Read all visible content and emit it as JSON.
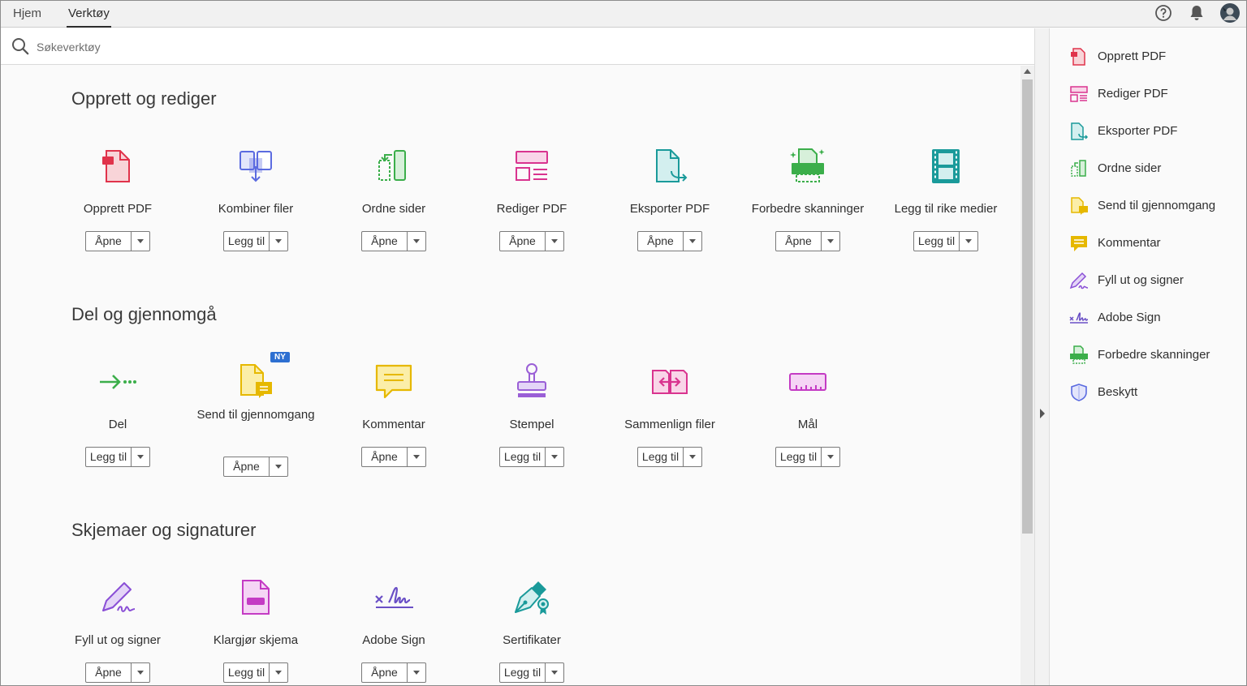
{
  "tabs": {
    "home": "Hjem",
    "tools": "Verktøy"
  },
  "search": {
    "placeholder": "Søkeverktøy"
  },
  "sections": [
    {
      "title": "Opprett og rediger",
      "tools": [
        {
          "label": "Opprett PDF",
          "button": "Åpne",
          "icon": "create-pdf-icon"
        },
        {
          "label": "Kombiner filer",
          "button": "Legg til",
          "icon": "combine-files-icon"
        },
        {
          "label": "Ordne sider",
          "button": "Åpne",
          "icon": "organize-pages-icon"
        },
        {
          "label": "Rediger PDF",
          "button": "Åpne",
          "icon": "edit-pdf-icon"
        },
        {
          "label": "Eksporter PDF",
          "button": "Åpne",
          "icon": "export-pdf-icon"
        },
        {
          "label": "Forbedre skanninger",
          "button": "Åpne",
          "icon": "enhance-scans-icon"
        },
        {
          "label": "Legg til rike medier",
          "button": "Legg til",
          "icon": "rich-media-icon"
        }
      ]
    },
    {
      "title": "Del og gjennomgå",
      "tools": [
        {
          "label": "Del",
          "button": "Legg til",
          "icon": "share-icon"
        },
        {
          "label": "Send til gjennomgang",
          "button": "Åpne",
          "icon": "send-review-icon",
          "badge": "NY"
        },
        {
          "label": "Kommentar",
          "button": "Åpne",
          "icon": "comment-icon"
        },
        {
          "label": "Stempel",
          "button": "Legg til",
          "icon": "stamp-icon"
        },
        {
          "label": "Sammenlign filer",
          "button": "Legg til",
          "icon": "compare-files-icon"
        },
        {
          "label": "Mål",
          "button": "Legg til",
          "icon": "measure-icon"
        }
      ]
    },
    {
      "title": "Skjemaer og signaturer",
      "tools": [
        {
          "label": "Fyll ut og signer",
          "button": "Åpne",
          "icon": "fill-sign-icon"
        },
        {
          "label": "Klargjør skjema",
          "button": "Legg til",
          "icon": "prepare-form-icon"
        },
        {
          "label": "Adobe Sign",
          "button": "Åpne",
          "icon": "adobe-sign-icon"
        },
        {
          "label": "Sertifikater",
          "button": "Legg til",
          "icon": "certificates-icon"
        }
      ]
    }
  ],
  "right_panel": [
    {
      "label": "Opprett PDF",
      "icon": "create-pdf-icon"
    },
    {
      "label": "Rediger PDF",
      "icon": "edit-pdf-icon"
    },
    {
      "label": "Eksporter PDF",
      "icon": "export-pdf-icon"
    },
    {
      "label": "Ordne sider",
      "icon": "organize-pages-icon"
    },
    {
      "label": "Send til gjennomgang",
      "icon": "send-review-icon"
    },
    {
      "label": "Kommentar",
      "icon": "comment-icon"
    },
    {
      "label": "Fyll ut og signer",
      "icon": "fill-sign-icon"
    },
    {
      "label": "Adobe Sign",
      "icon": "adobe-sign-icon"
    },
    {
      "label": "Forbedre skanninger",
      "icon": "enhance-scans-icon"
    },
    {
      "label": "Beskytt",
      "icon": "protect-icon"
    }
  ],
  "colors": {
    "red": "#e0334b",
    "blue": "#5b6be0",
    "green": "#3bae4a",
    "pink": "#d9348f",
    "teal": "#1a9a9a",
    "yellow": "#e6b800",
    "purple": "#8a4fd6",
    "magenta": "#c43bc4"
  }
}
